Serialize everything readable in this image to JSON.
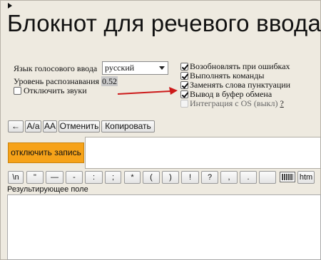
{
  "header": {
    "title": "Блокнот для речевого ввода",
    "play_icon": "play-triangle-icon"
  },
  "settings": {
    "language_label": "Язык голосового ввода",
    "language_value": "русский",
    "recognition_level_label": "Уровень распознавания",
    "recognition_level_value": "0.52",
    "mute_label": "Отключить звуки",
    "mute_checked": false
  },
  "options": [
    {
      "label": "Возобновлять при ошибках",
      "checked": true,
      "enabled": true
    },
    {
      "label": "Выполнять команды",
      "checked": true,
      "enabled": true
    },
    {
      "label": "Заменять слова пунктуации",
      "checked": true,
      "enabled": true
    },
    {
      "label": "Вывод в буфер обмена",
      "checked": true,
      "enabled": true
    },
    {
      "label": "Интеграция с OS (выкл)",
      "checked": false,
      "enabled": false
    }
  ],
  "options_help": "?",
  "annotation": {
    "arrow_color": "#cc1a1a",
    "icon": "red-arrow-icon"
  },
  "toolbar": {
    "back": "←",
    "case_toggle": "A/a",
    "upper": "AA",
    "undo": "Отменить",
    "copy": "Копировать"
  },
  "record": {
    "label": "отключить запись",
    "color": "#f6a219"
  },
  "keys": [
    "\\n",
    "\"",
    "—",
    "-",
    ":",
    ";",
    "*",
    "(",
    ")",
    "!",
    "?",
    ",",
    ".",
    ""
  ],
  "keyboard_icon": "keyboard-icon",
  "html_button": "htm",
  "result": {
    "label": "Результирующее поле",
    "value": ""
  }
}
